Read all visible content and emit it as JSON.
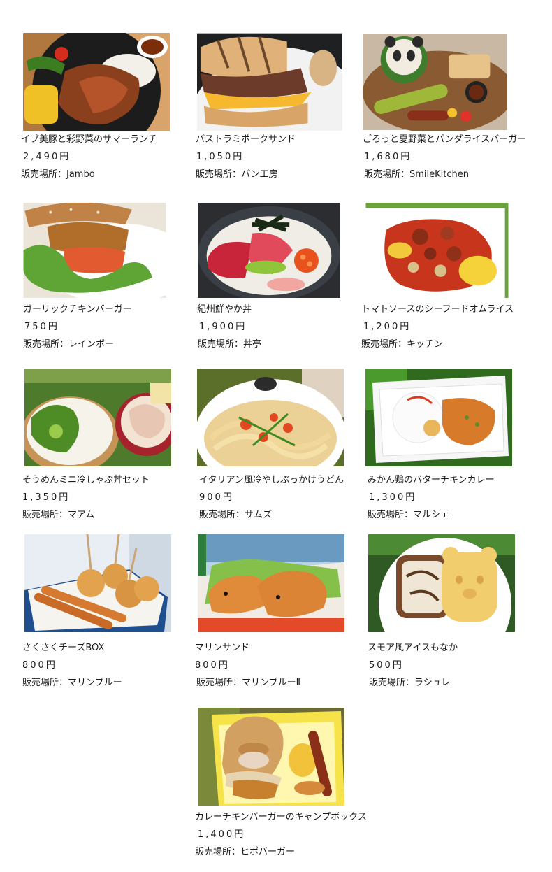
{
  "menu": [
    {
      "name": "イブ美豚と彩野菜のサマーランチ",
      "price": "2,490円",
      "shop": "販売場所：Jambo",
      "icon": "pork-steak-skillet"
    },
    {
      "name": "パストラミポークサンド",
      "price": "1,050円",
      "shop": "販売場所：パン工房",
      "icon": "pastrami-sandwich"
    },
    {
      "name": "ごろっと夏野菜とパンダライスバーガー",
      "price": "1,680円",
      "shop": "販売場所：SmileKitchen",
      "icon": "panda-rice-burger"
    },
    {
      "name": "ガーリックチキンバーガー",
      "price": "750円",
      "shop": "販売場所：レインボー",
      "icon": "chicken-burger"
    },
    {
      "name": "紀州鮮やか丼",
      "price": "1,900円",
      "shop": "販売場所：丼亭",
      "icon": "seafood-donburi"
    },
    {
      "name": "トマトソースのシーフードオムライス",
      "price": "1,200円",
      "shop": "販売場所：キッチン",
      "icon": "tomato-omurice"
    },
    {
      "name": "そうめんミニ冷しゃぶ丼セット",
      "price": "1,350円",
      "shop": "販売場所：マアム",
      "icon": "somen-set"
    },
    {
      "name": "イタリアン風冷やしぶっかけうどん",
      "price": "900円",
      "shop": "販売場所：サムズ",
      "icon": "udon-bowl"
    },
    {
      "name": "みかん鶏のバターチキンカレー",
      "price": "1,300円",
      "shop": "販売場所：マルシェ",
      "icon": "butter-chicken-curry"
    },
    {
      "name": "さくさくチーズBOX",
      "price": "800円",
      "shop": "販売場所：マリンブルー",
      "icon": "cheese-stick-box"
    },
    {
      "name": "マリンサンド",
      "price": "800円",
      "shop": "販売場所：マリンブルーⅡ",
      "icon": "dolphin-bread"
    },
    {
      "name": "スモア風アイスもなか",
      "price": "500円",
      "shop": "販売場所：ラシュレ",
      "icon": "bear-ice-monaka"
    },
    {
      "name": "カレーチキンバーガーのキャンプボックス",
      "price": "1,400円",
      "shop": "販売場所：ヒポバーガー",
      "icon": "camp-box"
    }
  ],
  "colors": {
    "text": "#1a1a1a",
    "background": "#ffffff"
  }
}
